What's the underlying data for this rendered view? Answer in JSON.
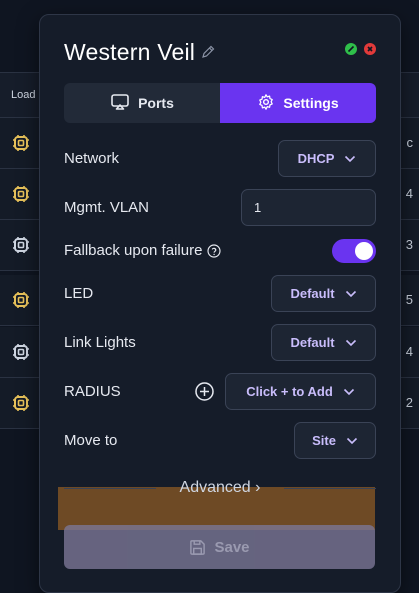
{
  "background_table": {
    "header_label": "Load",
    "row_tails": [
      "c",
      "4",
      "3",
      "5",
      "4",
      "2"
    ],
    "chip_colors": [
      "#e8c25a",
      "#e8c25a",
      "#cfd6e2",
      "#e8c25a",
      "#cfd6e2",
      "#e8c25a"
    ]
  },
  "panel": {
    "title": "Western Veil",
    "tabs": [
      {
        "label": "Ports",
        "icon": "airplay-icon",
        "active": false
      },
      {
        "label": "Settings",
        "icon": "gear-icon",
        "active": true
      }
    ],
    "fields": {
      "network": {
        "label": "Network",
        "value": "DHCP"
      },
      "mgmt_vlan": {
        "label": "Mgmt. VLAN",
        "value": "1"
      },
      "fallback": {
        "label": "Fallback upon failure",
        "enabled": true
      },
      "led": {
        "label": "LED",
        "value": "Default"
      },
      "link_lights": {
        "label": "Link Lights",
        "value": "Default"
      },
      "radius": {
        "label": "RADIUS",
        "value": "Click + to Add"
      },
      "move_to": {
        "label": "Move to",
        "value": "Site"
      }
    },
    "advanced_label": "Advanced",
    "save_label": "Save"
  },
  "colors": {
    "accent": "#6a34f0",
    "status_green": "#2fbf4a",
    "status_red": "#e23a3a"
  }
}
